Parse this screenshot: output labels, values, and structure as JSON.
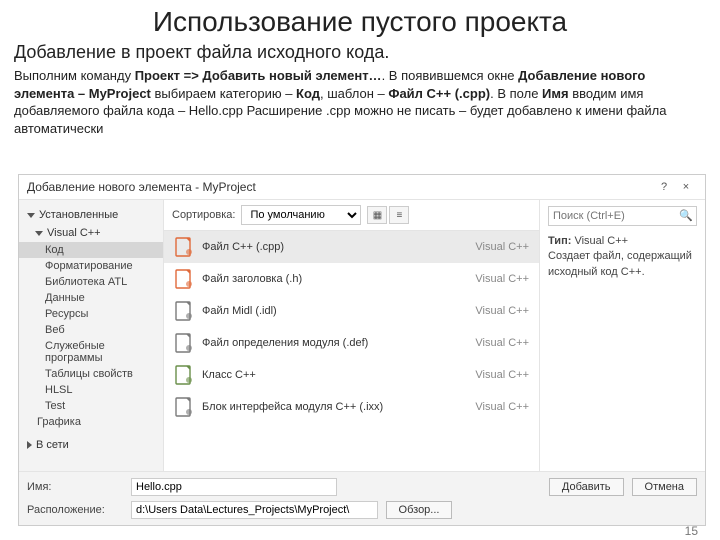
{
  "slide": {
    "title": "Использование пустого проекта",
    "subtitle": "Добавление в проект файла исходного кода.",
    "body_html": "Выполним команду <b>Проект => Добавить новый элемент…</b>. В появившемся окне <b>Добавление нового элемента – MyProject</b> выбираем категорию – <b>Код</b>, шаблон – <b>Файл C++ (.cpp)</b>. В поле <b>Имя</b> вводим имя добавляемого файла кода – Hello.cpp Расширение .cpp можно не писать – будет добавлено к имени файла автоматически",
    "pagenum": "15"
  },
  "dialog": {
    "title": "Добавление нового элемента  - MyProject",
    "help": "?",
    "close": "×",
    "sidebar": {
      "installed": "Установленные",
      "vcpp": "Visual C++",
      "items": [
        "Код",
        "Форматирование",
        "Библиотека ATL",
        "Данные",
        "Ресурсы",
        "Веб",
        "Служебные программы",
        "Таблицы свойств",
        "HLSL",
        "Test"
      ],
      "graphics": "Графика",
      "online": "В сети"
    },
    "sort": {
      "label": "Сортировка:",
      "value": "По умолчанию"
    },
    "templates": [
      {
        "name": "Файл C++ (.cpp)",
        "lang": "Visual C++",
        "icon": "cpp"
      },
      {
        "name": "Файл заголовка (.h)",
        "lang": "Visual C++",
        "icon": "h"
      },
      {
        "name": "Файл Midl (.idl)",
        "lang": "Visual C++",
        "icon": "idl"
      },
      {
        "name": "Файл определения модуля (.def)",
        "lang": "Visual C++",
        "icon": "def"
      },
      {
        "name": "Класс C++",
        "lang": "Visual C++",
        "icon": "class"
      },
      {
        "name": "Блок интерфейса модуля C++ (.ixx)",
        "lang": "Visual C++",
        "icon": "ixx"
      }
    ],
    "search": {
      "placeholder": "Поиск (Ctrl+E)"
    },
    "detail": {
      "type_label": "Тип:",
      "type": "Visual C++",
      "desc": "Создает файл, содержащий исходный код C++."
    },
    "footer": {
      "name_label": "Имя:",
      "name_value": "Hello.cpp",
      "loc_label": "Расположение:",
      "loc_value": "d:\\Users Data\\Lectures_Projects\\MyProject\\",
      "browse": "Обзор...",
      "add": "Добавить",
      "cancel": "Отмена"
    }
  }
}
